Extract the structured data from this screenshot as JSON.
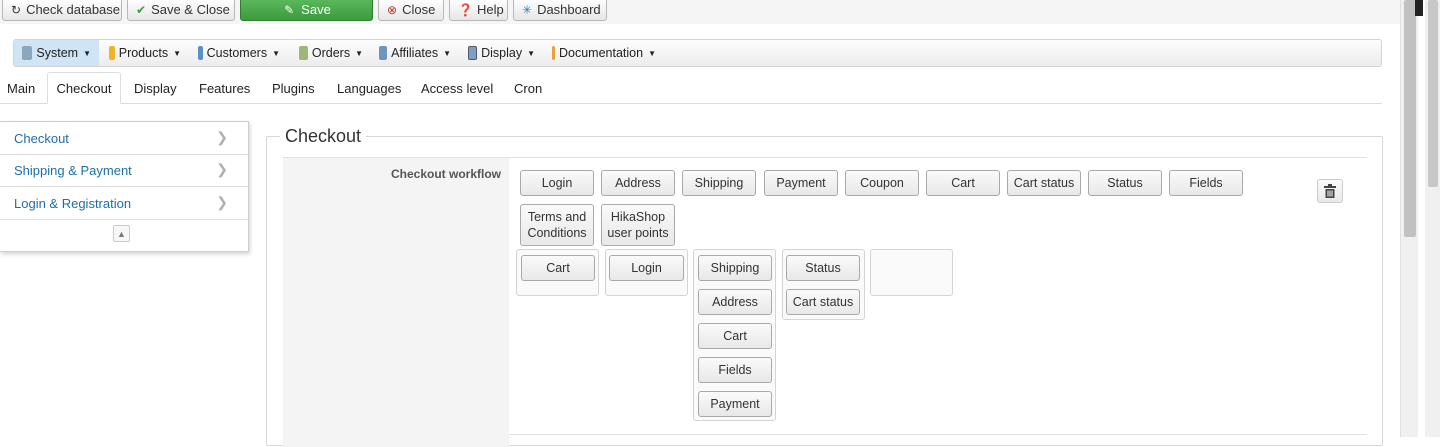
{
  "toolbar": {
    "check_database": "Check database",
    "save_close": "Save & Close",
    "save": "Save",
    "close": "Close",
    "help": "Help",
    "dashboard": "Dashboard"
  },
  "menu": {
    "items": [
      {
        "label": "System",
        "icon": "wrench-icon"
      },
      {
        "label": "Products",
        "icon": "box-icon"
      },
      {
        "label": "Customers",
        "icon": "users-icon"
      },
      {
        "label": "Orders",
        "icon": "clipboard-icon"
      },
      {
        "label": "Affiliates",
        "icon": "affiliate-icon"
      },
      {
        "label": "Display",
        "icon": "display-icon"
      },
      {
        "label": "Documentation",
        "icon": "gears-icon"
      }
    ],
    "active": "System"
  },
  "tabs": [
    "Main",
    "Checkout",
    "Display",
    "Features",
    "Plugins",
    "Languages",
    "Access level",
    "Cron"
  ],
  "active_tab": "Checkout",
  "sidebar": {
    "items": [
      "Checkout",
      "Shipping & Payment",
      "Login & Registration"
    ]
  },
  "section": {
    "legend": "Checkout",
    "field_label": "Checkout workflow"
  },
  "workflow": {
    "available": [
      "Login",
      "Address",
      "Shipping",
      "Payment",
      "Coupon",
      "Cart",
      "Cart status",
      "Status",
      "Fields"
    ],
    "available_row2": [
      "Terms and Conditions",
      "HikaShop user points"
    ],
    "steps": {
      "step1": [
        "Cart"
      ],
      "step2": [
        "Login"
      ],
      "step3": [
        "Shipping",
        "Address",
        "Cart",
        "Fields",
        "Payment"
      ],
      "step4": [
        "Status",
        "Cart status"
      ]
    }
  },
  "colors": {
    "save_green": "#4cae4c",
    "link_blue": "#1e6fa6",
    "menu_active": "#cfe4f4"
  }
}
